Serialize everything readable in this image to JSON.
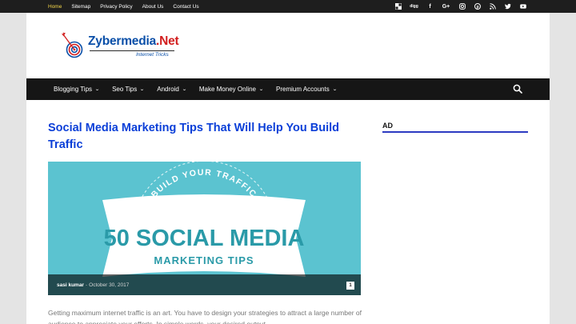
{
  "topbar": {
    "links": [
      "Home",
      "Sitemap",
      "Privacy Policy",
      "About Us",
      "Contact Us"
    ],
    "active_index": 0,
    "social_icons": [
      "delicious-icon",
      "digg-icon",
      "facebook-icon",
      "google-plus-icon",
      "instagram-icon",
      "pinterest-icon",
      "rss-icon",
      "twitter-icon",
      "youtube-icon"
    ]
  },
  "logo": {
    "brand_main": "Zybermedia",
    "brand_dot": ".",
    "brand_tld": "Net",
    "tagline": "Internet Tricks"
  },
  "nav": {
    "items": [
      "Blogging Tips",
      "Seo Tips",
      "Android",
      "Make Money Online",
      "Premium Accounts"
    ]
  },
  "article": {
    "title": "Social Media Marketing Tips That Will Help You Build Traffic",
    "hero": {
      "arc_text": "BUILD YOUR TRAFFIC",
      "headline": "50 SOCIAL MEDIA",
      "subheadline": "MARKETING TIPS"
    },
    "author": "sasi kumar",
    "separator": "-",
    "date": "October 30, 2017",
    "comment_count": "1",
    "excerpt": "Getting maximum internet traffic is an art. You have to design your strategies to attract a large number of audience to appreciate your efforts. In simple words, your desired output"
  },
  "sidebar": {
    "ad_label": "AD"
  },
  "colors": {
    "brand_blue": "#0a4fa8",
    "brand_red": "#d21f1f",
    "title_blue": "#0b3fd8",
    "hero_teal": "#5bc3d0",
    "ad_rule": "#2d3bc2"
  }
}
